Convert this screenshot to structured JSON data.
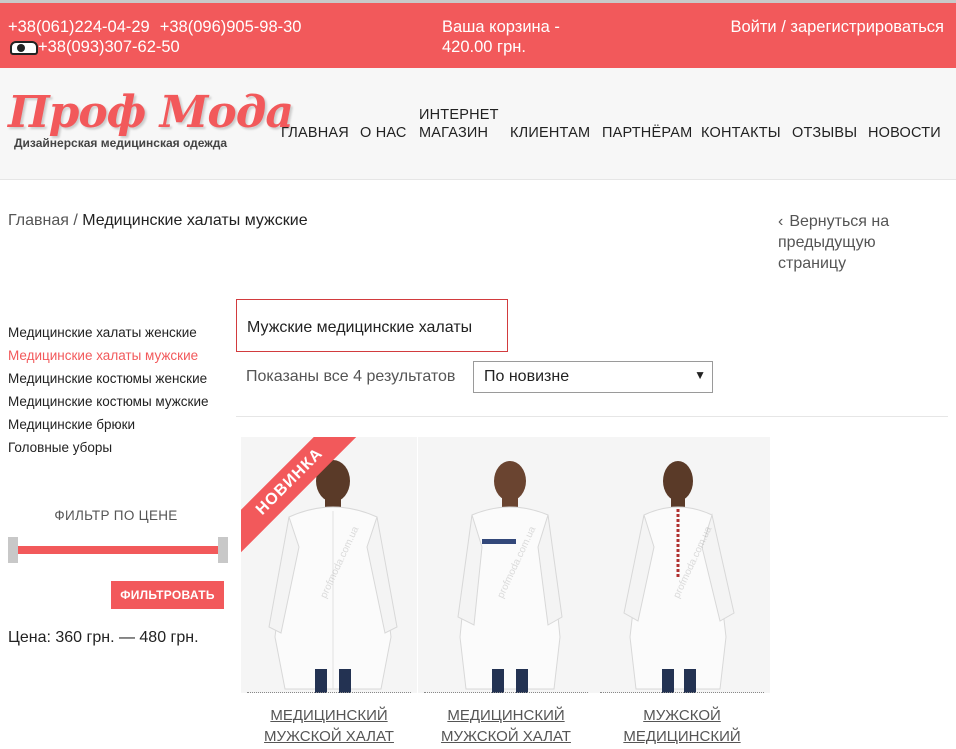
{
  "topbar": {
    "phone1": "+38(061)224-04-29",
    "phone2": "+38(096)905-98-30",
    "phone3": "+38(093)307-62-50",
    "cart_label": "Ваша корзина -",
    "cart_amount": "420.00 грн.",
    "login": "Войти / зарегистрироваться"
  },
  "logo": {
    "title": "Проф Мода",
    "subtitle": "Дизайнерская медицинская одежда"
  },
  "nav": {
    "items": [
      "ГЛАВНАЯ",
      "О НАС",
      "ИНТЕРНЕТ",
      "МАГАЗИН",
      "КЛИЕНТАМ",
      "ПАРТНЁРАМ",
      "КОНТАКТЫ",
      "ОТЗЫВЫ",
      "НОВОСТИ"
    ]
  },
  "breadcrumb": {
    "home": "Главная",
    "sep": "/",
    "current": "Медицинские халаты мужские",
    "back": "Вернуться на предыдущую страницу"
  },
  "sidebar": {
    "categories": [
      "Медицинские халаты женские",
      "Медицинские халаты мужские",
      "Медицинские костюмы женские",
      "Медицинские костюмы мужские",
      "Медицинские брюки",
      "Головные уборы"
    ],
    "filter_title": "ФИЛЬТР ПО ЦЕНЕ",
    "filter_button": "ФИЛЬТРОВАТЬ",
    "price": "Цена: 360 грн. — 480 грн."
  },
  "main": {
    "title": "Мужские медицинские халаты",
    "results": "Показаны все 4 результатов",
    "sort": "По новизне",
    "watermark": "profmoda.com.ua"
  },
  "products": [
    {
      "badge": "НОВИНКА",
      "name_line1": "МЕДИЦИНСКИЙ",
      "name_line2": "МУЖСКОЙ ХАЛАТ"
    },
    {
      "name_line1": "МЕДИЦИНСКИЙ",
      "name_line2": "МУЖСКОЙ ХАЛАТ"
    },
    {
      "name_line1": "МУЖСКОЙ",
      "name_line2": "МЕДИЦИНСКИЙ"
    }
  ],
  "colors": {
    "accent": "#f2595b",
    "header_bg": "#f7f7f7"
  }
}
